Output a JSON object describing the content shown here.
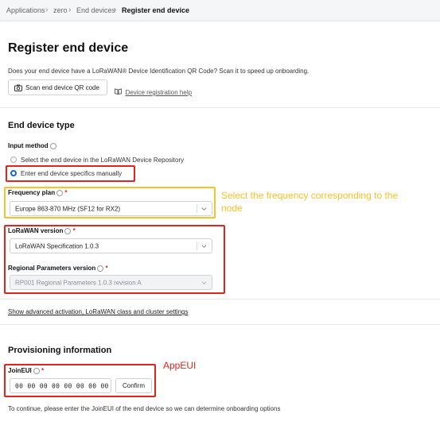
{
  "breadcrumb": {
    "items": [
      "Applications",
      "zero",
      "End devices"
    ],
    "current": "Register end device"
  },
  "page": {
    "title": "Register end device",
    "qr_prompt": "Does your end device have a LoRaWAN® Device Identification QR Code? Scan it to speed up onboarding.",
    "scan_button": "Scan end device QR code",
    "help_link": "Device registration help"
  },
  "end_device_type": {
    "heading": "End device type",
    "input_method_label": "Input method",
    "options": [
      "Select the end device in the LoRaWAN Device Repository",
      "Enter end device specifics manually"
    ],
    "selected_option": 1,
    "frequency_plan_label": "Frequency plan",
    "frequency_plan_value": "Europe 863-870 MHz (SF12 for RX2)",
    "lorawan_version_label": "LoRaWAN version",
    "lorawan_version_value": "LoRaWAN Specification 1.0.3",
    "regional_params_label": "Regional Parameters version",
    "regional_params_value": "RP001 Regional Parameters 1.0.3 revision A",
    "advanced_link": "Show advanced activation, LoRaWAN class and cluster settings"
  },
  "provisioning": {
    "heading": "Provisioning information",
    "join_eui_label": "JoinEUI",
    "join_eui_value": "00 00 00 00 00 00 00 00",
    "confirm_button": "Confirm",
    "help_text": "To continue, please enter the JoinEUI of the end device so we can determine onboarding options"
  },
  "annotations": {
    "frequency_note": [
      "Select the frequency corresponding to the",
      "node"
    ],
    "appeui_note": "AppEUI",
    "note_colors": {
      "yellow": "#f6c12a",
      "red": "#e0241e"
    }
  },
  "icons": {
    "breadcrumb_separator": "chevron-right-icon",
    "camera": "camera-icon",
    "book": "book-icon",
    "info": "info-icon",
    "dropdown": "chevron-down-icon"
  },
  "colors": {
    "accent": "#1466d8",
    "required": "#e0241e"
  },
  "required_mark": "*"
}
